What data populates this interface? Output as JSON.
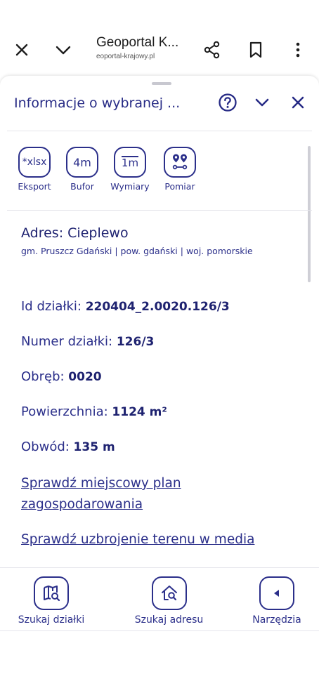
{
  "browser": {
    "title": "Geoportal K...",
    "url": "eoportal-krajowy.pl",
    "icons": [
      "close-icon",
      "chevron-down-icon",
      "share-icon",
      "bookmark-icon",
      "more-vert-icon"
    ]
  },
  "panel": {
    "title": "Informacje o wybranej ...",
    "tools": [
      {
        "label": "Eksport",
        "icon_text": "*xlsx"
      },
      {
        "label": "Bufor",
        "icon_text": "4m"
      },
      {
        "label": "Wymiary",
        "icon_text": "1m"
      },
      {
        "label": "Pomiar",
        "icon_text": ""
      }
    ]
  },
  "address": {
    "title": "Adres: Cieplewo",
    "subtitle": "gm. Pruszcz Gdański | pow. gdański | woj. pomorskie"
  },
  "fields": {
    "id": {
      "label": "Id działki: ",
      "value": "220404_2.0020.126/3"
    },
    "numer": {
      "label": "Numer działki: ",
      "value": "126/3"
    },
    "obreb": {
      "label": "Obręb: ",
      "value": "0020"
    },
    "powierzchnia": {
      "label": "Powierzchnia: ",
      "value": "1124 m²"
    },
    "obwod": {
      "label": "Obwód: ",
      "value": "135 m"
    }
  },
  "links": {
    "plan": "Sprawdź miejscowy plan zagospodarowania",
    "media": "Sprawdź uzbrojenie terenu w media"
  },
  "bottom_nav": {
    "search_plot": "Szukaj działki",
    "search_address": "Szukaj adresu",
    "tools": "Narzędzia"
  },
  "colors": {
    "accent": "#2b2f8a",
    "text_dark": "#1e2270"
  }
}
